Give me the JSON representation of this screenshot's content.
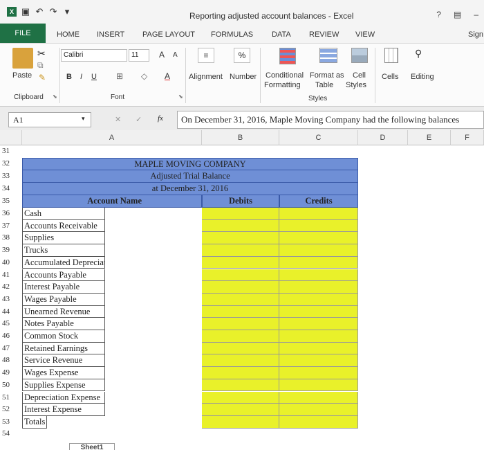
{
  "window": {
    "title": "Reporting adjusted account balances - Excel",
    "help": "?",
    "signin": "Sign"
  },
  "tabs": [
    "FILE",
    "HOME",
    "INSERT",
    "PAGE LAYOUT",
    "FORMULAS",
    "DATA",
    "REVIEW",
    "VIEW"
  ],
  "ribbon": {
    "clipboard": {
      "paste": "Paste",
      "group": "Clipboard"
    },
    "font": {
      "name": "Calibri",
      "size": "11",
      "bold": "B",
      "italic": "I",
      "underline": "U",
      "grow": "A",
      "shrink": "A",
      "group": "Font",
      "color_letter": "A"
    },
    "alignment": {
      "label": "Alignment"
    },
    "number": {
      "label": "Number",
      "percent": "%"
    },
    "styles": {
      "conditional": "Conditional",
      "formatting": "Formatting",
      "format_as": "Format as",
      "table": "Table",
      "cell": "Cell",
      "styles": "Styles",
      "group": "Styles"
    },
    "cells": {
      "label": "Cells"
    },
    "editing": {
      "label": "Editing"
    }
  },
  "formula_bar": {
    "name_box": "A1",
    "fx": "fx",
    "cancel": "✕",
    "enter": "✓",
    "content": "On December 31, 2016, Maple Moving Company had the following balances"
  },
  "columns": [
    "A",
    "B",
    "C",
    "D",
    "E",
    "F"
  ],
  "rows": {
    "r31": "31",
    "r32": "32",
    "r33": "33",
    "r34": "34",
    "r35": "35"
  },
  "header_block": {
    "company": "MAPLE MOVING COMPANY",
    "report": "Adjusted Trial Balance",
    "date": "at December 31, 2016",
    "col_account": "Account Name",
    "col_debits": "Debits",
    "col_credits": "Credits"
  },
  "accounts": [
    {
      "row": "36",
      "name": "Cash"
    },
    {
      "row": "37",
      "name": "Accounts Receivable"
    },
    {
      "row": "38",
      "name": "Supplies"
    },
    {
      "row": "39",
      "name": "Trucks"
    },
    {
      "row": "40",
      "name": "Accumulated Depreciation"
    },
    {
      "row": "41",
      "name": "Accounts Payable"
    },
    {
      "row": "42",
      "name": "Interest Payable"
    },
    {
      "row": "43",
      "name": "Wages Payable"
    },
    {
      "row": "44",
      "name": "Unearned Revenue"
    },
    {
      "row": "45",
      "name": "Notes Payable"
    },
    {
      "row": "46",
      "name": "Common Stock"
    },
    {
      "row": "47",
      "name": "Retained Earnings"
    },
    {
      "row": "48",
      "name": "Service Revenue"
    },
    {
      "row": "49",
      "name": "Wages Expense"
    },
    {
      "row": "50",
      "name": "Supplies Expense"
    },
    {
      "row": "51",
      "name": "Depreciation Expense"
    },
    {
      "row": "52",
      "name": "Interest Expense"
    },
    {
      "row": "53",
      "name": "Totals"
    }
  ],
  "last_row": "54",
  "sheet_tab": "Sheet1",
  "colors": {
    "excel_green": "#1f7145",
    "header_blue": "#6f8fd6",
    "input_yellow": "#e9f12a"
  }
}
